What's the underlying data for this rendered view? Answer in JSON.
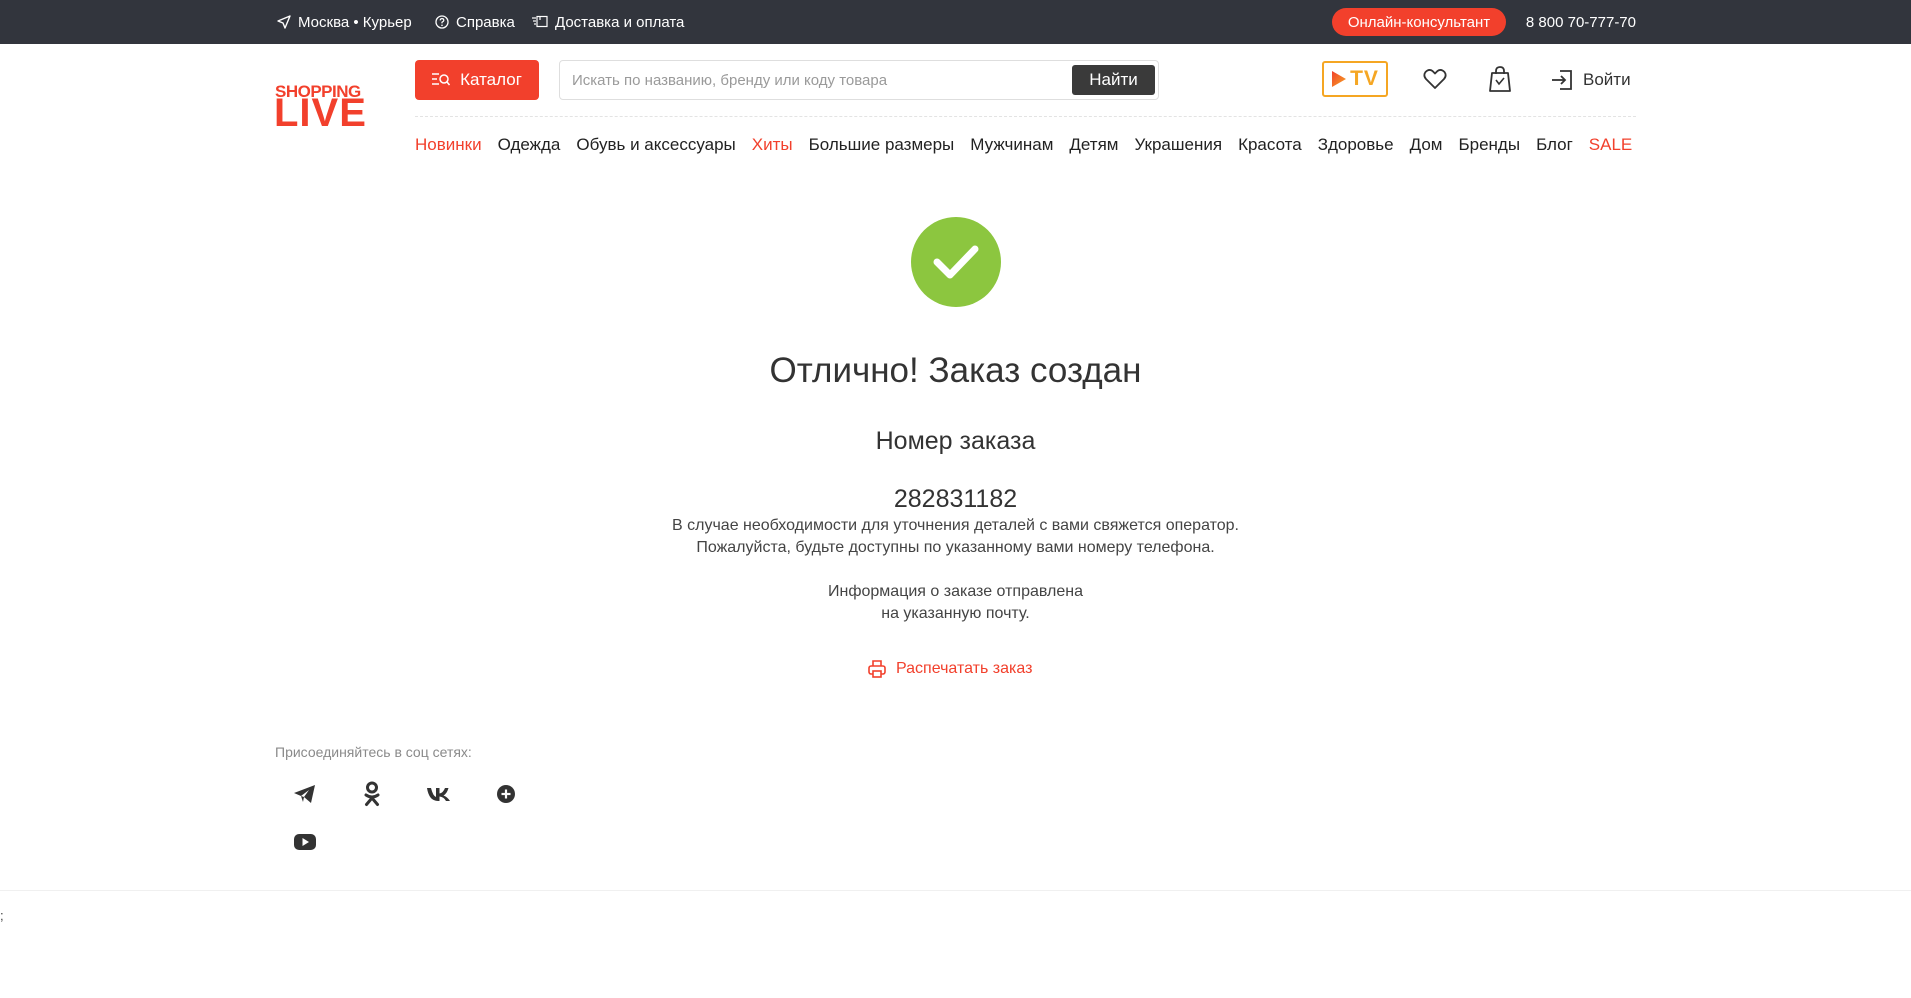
{
  "topbar": {
    "location": "Москва • Курьер",
    "help": "Справка",
    "delivery": "Доставка и оплата",
    "consultant": "Онлайн-консультант",
    "phone": "8 800 70-777-70"
  },
  "header": {
    "logo_top": "SHOPPING",
    "logo_bottom": "LIVE",
    "catalog": "Каталог",
    "search_placeholder": "Искать по названию, бренду или коду товара",
    "search_button": "Найти",
    "tv": "TV",
    "login": "Войти"
  },
  "nav": [
    {
      "label": "Новинки",
      "accent": true
    },
    {
      "label": "Одежда",
      "accent": false
    },
    {
      "label": "Обувь и аксессуары",
      "accent": false
    },
    {
      "label": "Хиты",
      "accent": true
    },
    {
      "label": "Большие размеры",
      "accent": false
    },
    {
      "label": "Мужчинам",
      "accent": false
    },
    {
      "label": "Детям",
      "accent": false
    },
    {
      "label": "Украшения",
      "accent": false
    },
    {
      "label": "Красота",
      "accent": false
    },
    {
      "label": "Здоровье",
      "accent": false
    },
    {
      "label": "Дом",
      "accent": false
    },
    {
      "label": "Бренды",
      "accent": false
    },
    {
      "label": "Блог",
      "accent": false
    },
    {
      "label": "SALE",
      "accent": true
    }
  ],
  "order": {
    "title": "Отлично! Заказ создан",
    "number_label": "Номер заказа",
    "number": "282831182",
    "note_line1": "В случае необходимости для уточнения деталей с вами свяжется оператор.",
    "note_line2": "Пожалуйста, будьте доступны по указанному вами номеру телефона.",
    "note_line3": "Информация о заказе отправлена",
    "note_line4": "на указанную почту.",
    "print": "Распечатать заказ"
  },
  "social": {
    "title": "Присоединяйтесь в соц сетях:",
    "icons": [
      "telegram-icon",
      "odnoklassniki-icon",
      "vk-icon",
      "plus-icon",
      "youtube-icon"
    ]
  },
  "stray_char": ";",
  "colors": {
    "accent": "#f2402c",
    "topbar": "#32353d",
    "success": "#8cc63f",
    "tv": "#f5a623"
  }
}
